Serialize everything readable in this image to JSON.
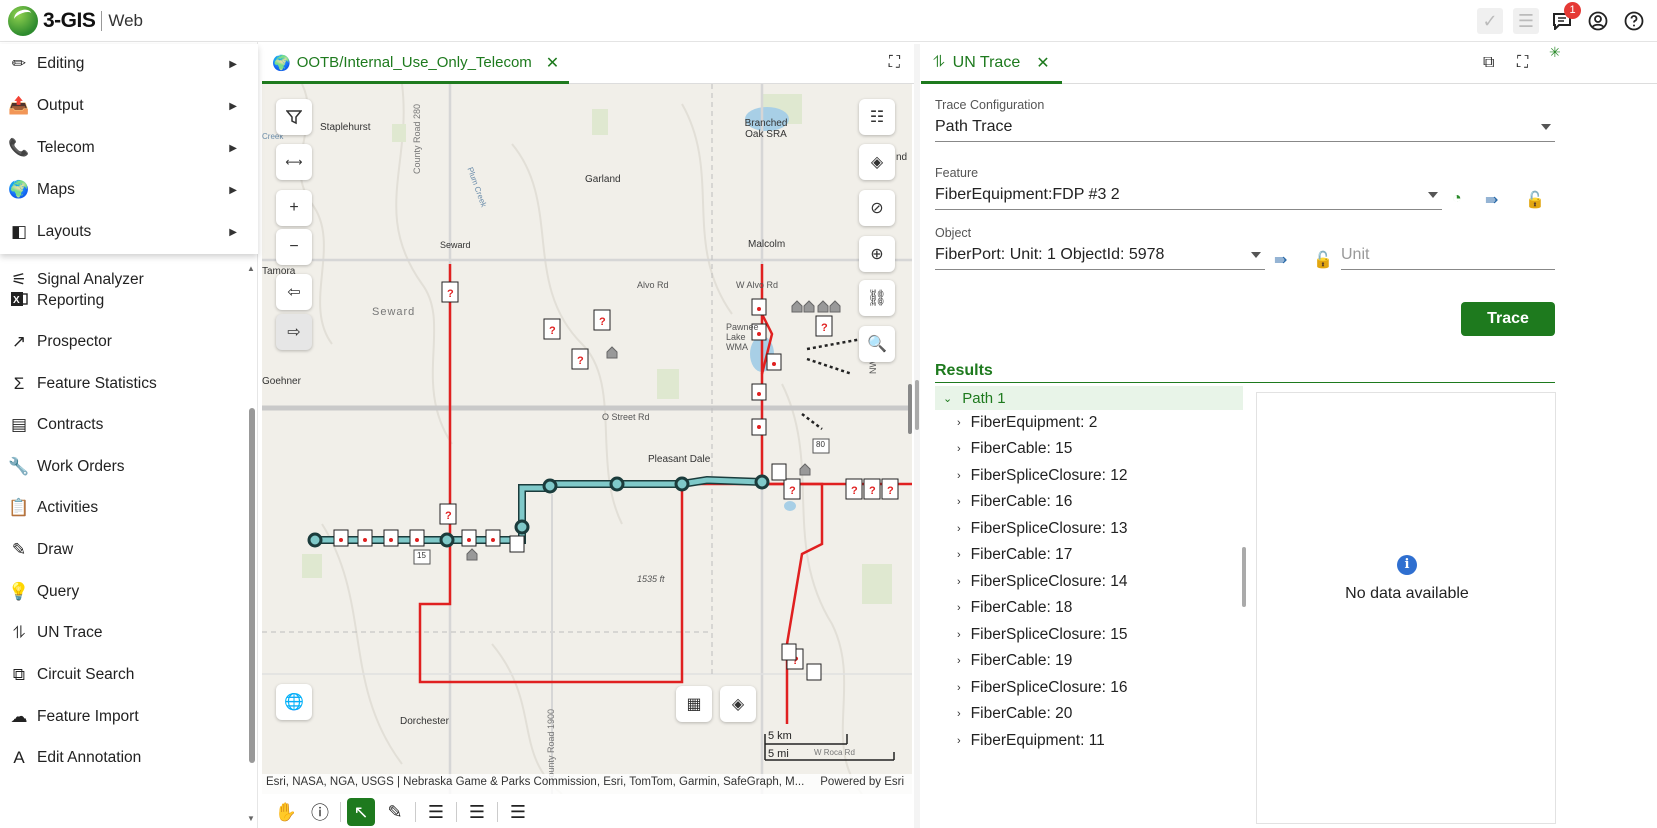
{
  "app": {
    "logo_text": "3-GIS",
    "logo_sub": "Web",
    "notification_count": "1"
  },
  "sidebar": {
    "menu": [
      {
        "label": "Editing",
        "icon": "pencil-icon"
      },
      {
        "label": "Output",
        "icon": "output-icon"
      },
      {
        "label": "Telecom",
        "icon": "phone-icon"
      },
      {
        "label": "Maps",
        "icon": "globe-icon"
      },
      {
        "label": "Layouts",
        "icon": "layout-icon"
      }
    ],
    "items": [
      {
        "label": "Signal Analyzer"
      },
      {
        "label": "Reporting"
      },
      {
        "label": "Prospector"
      },
      {
        "label": "Feature Statistics"
      },
      {
        "label": "Contracts"
      },
      {
        "label": "Work Orders"
      },
      {
        "label": "Activities"
      },
      {
        "label": "Draw"
      },
      {
        "label": "Query"
      },
      {
        "label": "UN Trace"
      },
      {
        "label": "Circuit Search"
      },
      {
        "label": "Feature Import"
      },
      {
        "label": "Edit Annotation"
      }
    ]
  },
  "map": {
    "tab_label": "OOTB/Internal_Use_Only_Telecom",
    "places": [
      "Staplehurst",
      "Garland",
      "Branched Oak SRA",
      "Malcolm",
      "Seward",
      "Tamora",
      "Goehner",
      "Pawnee Lake WMA",
      "Pleasant Dale",
      "Dorchester",
      "Seward"
    ],
    "roads": [
      "Alvo Rd",
      "W Alvo Rd",
      "O Street Rd",
      "County Road 280",
      "County Road 1900",
      "W Roca Rd",
      "Plum Creek",
      "Creek"
    ],
    "route_numbers": [
      "15",
      "80"
    ],
    "elevation": "1535 ft",
    "scale_km": "5 km",
    "scale_mi": "5 mi",
    "attribution": "Esri, NASA, NGA, USGS | Nebraska Game & Parks Commission, Esri, TomTom, Garmin, SafeGraph, M...",
    "powered": "Powered by Esri",
    "label_nd": "nd",
    "label_nw": "NW"
  },
  "trace": {
    "tab_label": "UN Trace",
    "config_label": "Trace Configuration",
    "config_value": "Path Trace",
    "feature_label": "Feature",
    "feature_value": "FiberEquipment:FDP #3 2",
    "object_label": "Object",
    "object_value": "FiberPort: Unit: 1 ObjectId: 5978",
    "unit_placeholder": "Unit",
    "trace_button": "Trace",
    "results_label": "Results",
    "path_label": "Path 1",
    "results": [
      "FiberEquipment: 2",
      "FiberCable: 15",
      "FiberSpliceClosure: 12",
      "FiberCable: 16",
      "FiberSpliceClosure: 13",
      "FiberCable: 17",
      "FiberSpliceClosure: 14",
      "FiberCable: 18",
      "FiberSpliceClosure: 15",
      "FiberCable: 19",
      "FiberSpliceClosure: 16",
      "FiberCable: 20",
      "FiberEquipment: 11"
    ],
    "no_data": "No data available"
  },
  "colors": {
    "accent": "#1e7a1e",
    "cable": "#e02020",
    "trace": "#7fc9c9"
  }
}
